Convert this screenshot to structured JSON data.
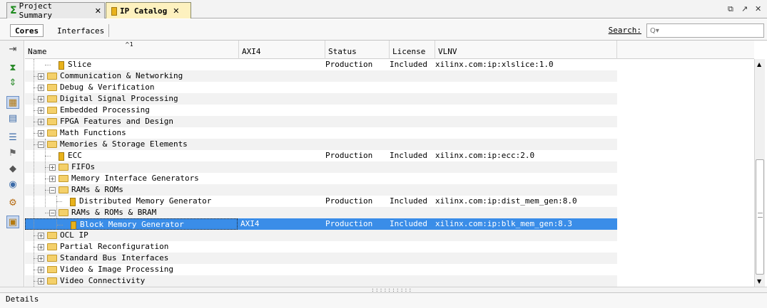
{
  "tabs": [
    {
      "label": "Project Summary",
      "active": false
    },
    {
      "label": "IP Catalog",
      "active": true
    }
  ],
  "window_controls": {
    "restore": "⧉",
    "maximize": "↗",
    "close": "✕"
  },
  "subtabs": {
    "cores": "Cores",
    "interfaces": "Interfaces"
  },
  "search": {
    "label": "Search:",
    "placeholder": "Q▾"
  },
  "columns": {
    "name": "Name",
    "axi4": "AXI4",
    "status": "Status",
    "license": "License",
    "vlnv": "VLNV",
    "sort_indicator": "^1"
  },
  "rows": [
    {
      "name": "Slice",
      "type": "ip",
      "level": 2,
      "axi4": "",
      "status": "Production",
      "license": "Included",
      "vlnv": "xilinx.com:ip:xlslice:1.0"
    },
    {
      "name": "Communication & Networking",
      "type": "folder",
      "level": 1,
      "expander": "+"
    },
    {
      "name": "Debug & Verification",
      "type": "folder",
      "level": 1,
      "expander": "+"
    },
    {
      "name": "Digital Signal Processing",
      "type": "folder",
      "level": 1,
      "expander": "+"
    },
    {
      "name": "Embedded Processing",
      "type": "folder",
      "level": 1,
      "expander": "+"
    },
    {
      "name": "FPGA Features and Design",
      "type": "folder",
      "level": 1,
      "expander": "+"
    },
    {
      "name": "Math Functions",
      "type": "folder",
      "level": 1,
      "expander": "+"
    },
    {
      "name": "Memories & Storage Elements",
      "type": "folder",
      "level": 1,
      "expander": "−"
    },
    {
      "name": "ECC",
      "type": "ip",
      "level": 2,
      "axi4": "",
      "status": "Production",
      "license": "Included",
      "vlnv": "xilinx.com:ip:ecc:2.0"
    },
    {
      "name": "FIFOs",
      "type": "folder",
      "level": 2,
      "expander": "+"
    },
    {
      "name": "Memory Interface Generators",
      "type": "folder",
      "level": 2,
      "expander": "+"
    },
    {
      "name": "RAMs & ROMs",
      "type": "folder",
      "level": 2,
      "expander": "−"
    },
    {
      "name": "Distributed Memory Generator",
      "type": "ip",
      "level": 3,
      "axi4": "",
      "status": "Production",
      "license": "Included",
      "vlnv": "xilinx.com:ip:dist_mem_gen:8.0"
    },
    {
      "name": "RAMs & ROMs & BRAM",
      "type": "folder",
      "level": 2,
      "expander": "−"
    },
    {
      "name": "Block Memory Generator",
      "type": "ip",
      "level": 3,
      "axi4": "AXI4",
      "status": "Production",
      "license": "Included",
      "vlnv": "xilinx.com:ip:blk_mem_gen:8.3",
      "selected": true
    },
    {
      "name": "OCL IP",
      "type": "folder",
      "level": 1,
      "expander": "+"
    },
    {
      "name": "Partial Reconfiguration",
      "type": "folder",
      "level": 1,
      "expander": "+"
    },
    {
      "name": "Standard Bus Interfaces",
      "type": "folder",
      "level": 1,
      "expander": "+"
    },
    {
      "name": "Video & Image Processing",
      "type": "folder",
      "level": 1,
      "expander": "+"
    },
    {
      "name": "Video Connectivity",
      "type": "folder",
      "level": 1,
      "expander": "+"
    }
  ],
  "details": {
    "label": "Details"
  },
  "toolbar_icons": [
    "collapse-all-icon",
    "expand-all-icon",
    "group-by-icon",
    "filter-icon",
    "customize-ip-icon",
    "repository-icon",
    "compatible-families-icon",
    "ip-settings-icon",
    "settings-icon",
    "show-details-icon"
  ]
}
